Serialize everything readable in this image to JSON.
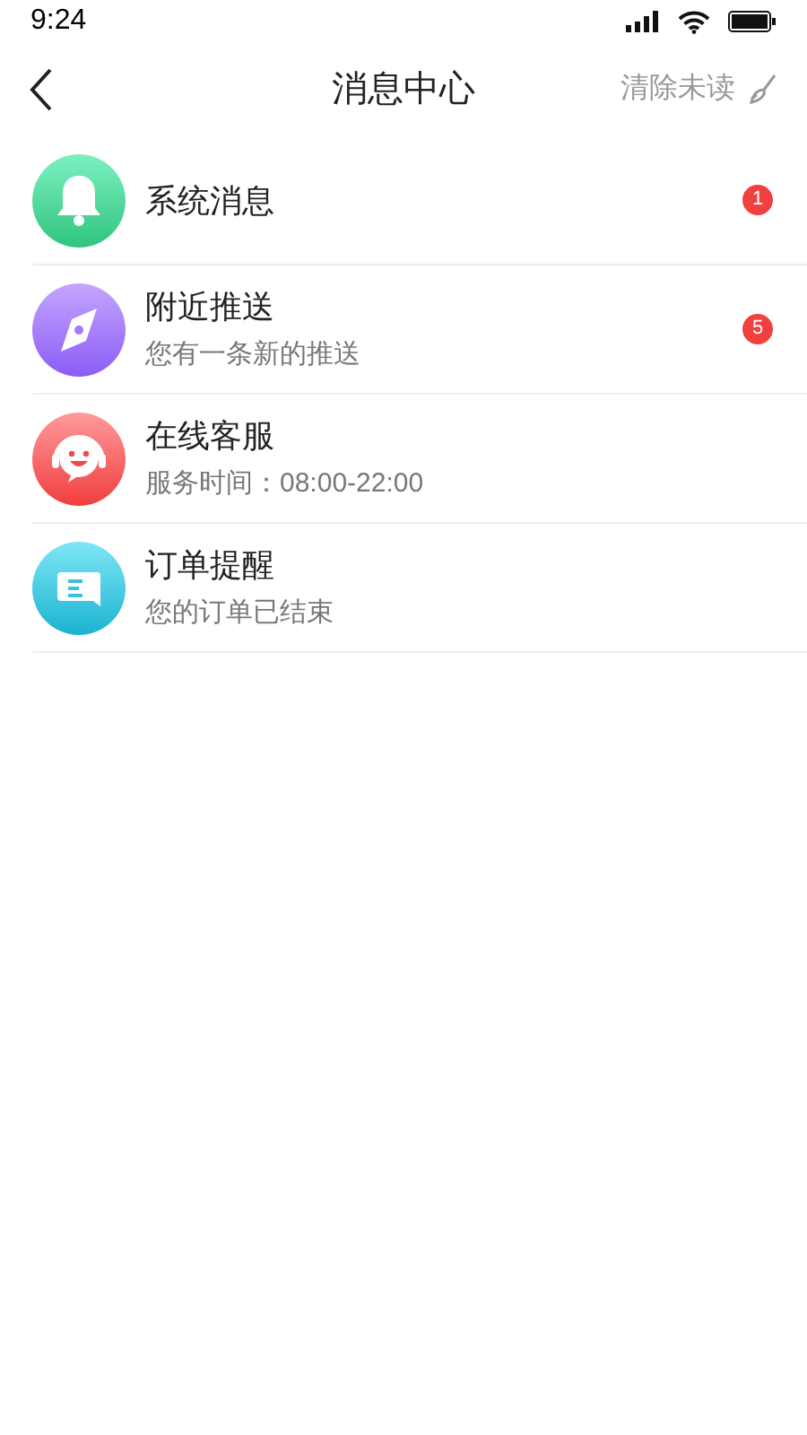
{
  "status_bar": {
    "time": "9:24"
  },
  "nav": {
    "title": "消息中心",
    "action": "清除未读"
  },
  "messages": [
    {
      "kind": "bell",
      "title": "系统消息",
      "badge": "1"
    },
    {
      "kind": "compass",
      "title": "附近推送",
      "subtitle": "您有一条新的推送",
      "badge": "5"
    },
    {
      "kind": "support",
      "title": "在线客服",
      "subtitle": "服务时间：08:00-22:00"
    },
    {
      "kind": "chat",
      "title": "订单提醒",
      "subtitle": "您的订单已结束"
    }
  ]
}
